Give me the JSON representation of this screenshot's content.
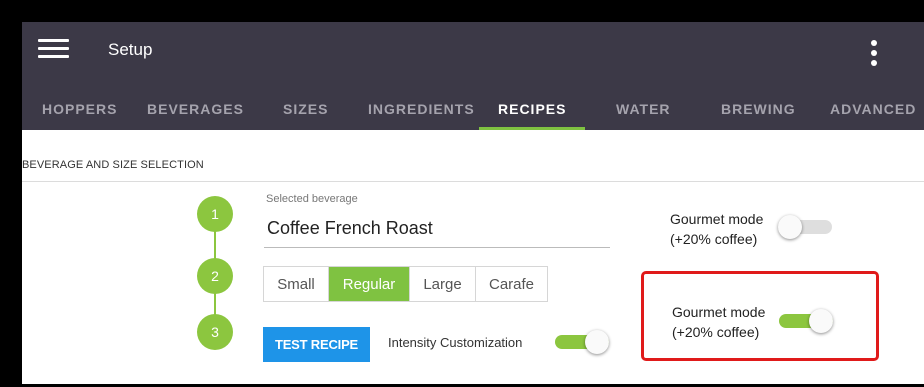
{
  "appbar": {
    "title": "Setup",
    "menu_icon": "hamburger-menu-icon",
    "overflow_icon": "more-vert-icon"
  },
  "tabs": [
    {
      "label": "HOPPERS"
    },
    {
      "label": "BEVERAGES"
    },
    {
      "label": "SIZES"
    },
    {
      "label": "INGREDIENTS"
    },
    {
      "label": "RECIPES",
      "active": true
    },
    {
      "label": "WATER"
    },
    {
      "label": "BREWING"
    },
    {
      "label": "ADVANCED"
    }
  ],
  "section": {
    "title": "BEVERAGE AND SIZE SELECTION"
  },
  "steps": [
    "1",
    "2",
    "3"
  ],
  "beverage": {
    "label": "Selected beverage",
    "value": "Coffee French Roast"
  },
  "sizes": {
    "options": [
      "Small",
      "Regular",
      "Large",
      "Carafe"
    ],
    "selected": "Regular"
  },
  "test_button": {
    "label": "TEST RECIPE"
  },
  "intensity": {
    "label": "Intensity Customization",
    "on": true
  },
  "gourmet_off": {
    "line1": "Gourmet mode",
    "line2": "(+20% coffee)",
    "on": false
  },
  "gourmet_on": {
    "line1": "Gourmet mode",
    "line2": "(+20% coffee)",
    "on": true
  },
  "colors": {
    "appbar": "#3c3947",
    "accent_green": "#8cc63f",
    "button_blue": "#1e94e8",
    "highlight_red": "#e01a1a"
  }
}
